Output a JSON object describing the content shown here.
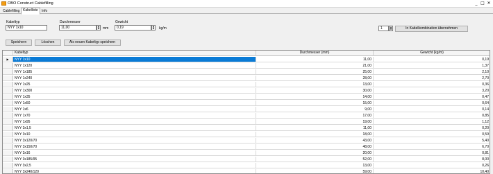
{
  "window": {
    "title": "OBO Construct Cablefilling",
    "minimize": "_",
    "maximize": "□",
    "close": "✕"
  },
  "tabs": [
    "Cablefilling",
    "Kabelliste",
    "Info"
  ],
  "form": {
    "kabeltyp_label": "Kabeltyp",
    "kabeltyp_value": "NYY 1x10",
    "durchmesser_label": "Durchmesser",
    "durchmesser_value": "11,00",
    "durchmesser_unit": "mm",
    "gewicht_label": "Gewicht",
    "gewicht_value": "0,19",
    "gewicht_unit": "kg/m",
    "quantity_value": "1",
    "uebernehmen_label": "In Kabelkombination übernehmen",
    "speichern_label": "Speichern",
    "loeschen_label": "Löschen",
    "neu_speichern_label": "Als neuen Kabeltyp speichern"
  },
  "table": {
    "columns": [
      "Kabeltyp",
      "Durchmesser (mm)",
      "Gewicht (kg/m)"
    ],
    "current_row_marker": "▶",
    "rows": [
      [
        "NYY  1x10",
        "11,00",
        "0,19"
      ],
      [
        "NYY  1x120",
        "21,00",
        "1,37"
      ],
      [
        "NYY  1x185",
        "25,00",
        "2,10"
      ],
      [
        "NYY  1x240",
        "28,00",
        "2,70"
      ],
      [
        "NYY  1x25",
        "13,00",
        "0,36"
      ],
      [
        "NYY  1x300",
        "30,00",
        "3,20"
      ],
      [
        "NYY  1x35",
        "14,00",
        "0,47"
      ],
      [
        "NYY  1x50",
        "15,00",
        "0,64"
      ],
      [
        "NYY  1x6",
        "9,00",
        "0,14"
      ],
      [
        "NYY  1x70",
        "17,00",
        "0,85"
      ],
      [
        "NYY  1x95",
        "19,00",
        "1,12"
      ],
      [
        "NYY  3x1,5",
        "11,00",
        "0,20"
      ],
      [
        "NYY  3x10",
        "18,00",
        "0,59"
      ],
      [
        "NYY  3x120/70",
        "43,00",
        "5,40"
      ],
      [
        "NYY  3x150/70",
        "48,00",
        "6,70"
      ],
      [
        "NYY  3x16",
        "20,00",
        "0,81"
      ],
      [
        "NYY  3x185/95",
        "52,00",
        "8,00"
      ],
      [
        "NYY  3x2,5",
        "13,00",
        "0,26"
      ],
      [
        "NYY  3x240/120",
        "59,00",
        "10,40"
      ]
    ]
  },
  "colors": {
    "selection": "#0a7bd6"
  }
}
